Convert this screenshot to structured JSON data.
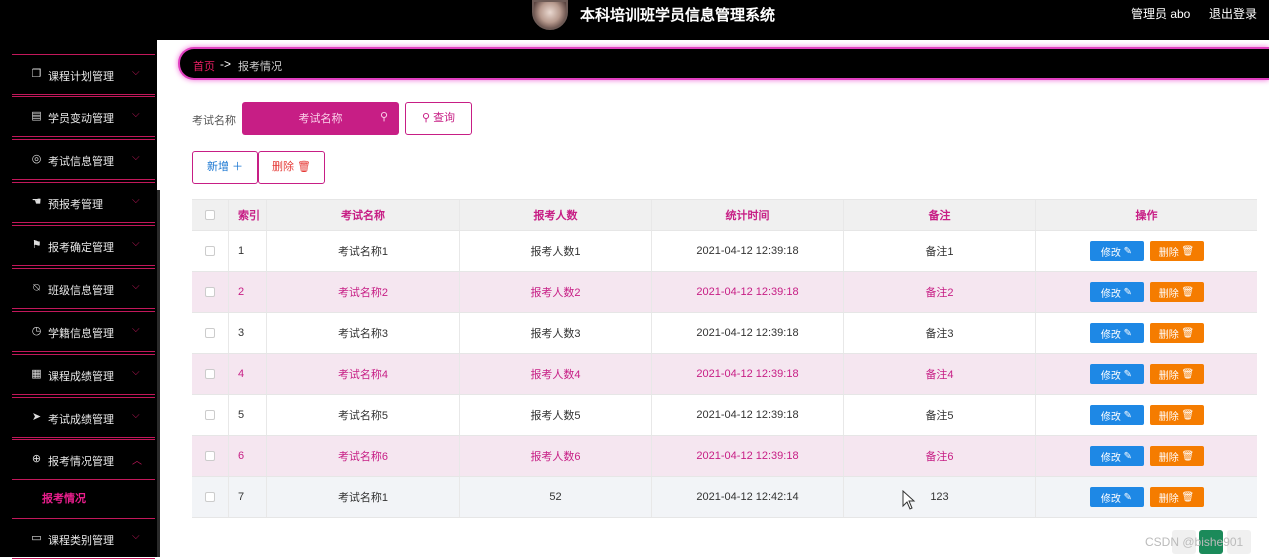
{
  "header": {
    "app_title": "本科培训班学员信息管理系统",
    "user_label": "管理员 abo",
    "logout_label": "退出登录"
  },
  "sidebar": {
    "items": [
      {
        "label": "课程计划管理",
        "icon": "copy-icon"
      },
      {
        "label": "学员变动管理",
        "icon": "chart-icon"
      },
      {
        "label": "考试信息管理",
        "icon": "compass-icon"
      },
      {
        "label": "预报考管理",
        "icon": "thumb-icon"
      },
      {
        "label": "报考确定管理",
        "icon": "flag-icon"
      },
      {
        "label": "班级信息管理",
        "icon": "bell-off-icon"
      },
      {
        "label": "学籍信息管理",
        "icon": "time-icon"
      },
      {
        "label": "课程成绩管理",
        "icon": "grid-icon"
      },
      {
        "label": "考试成绩管理",
        "icon": "send-icon"
      },
      {
        "label": "报考情况管理",
        "icon": "target-icon"
      },
      {
        "label": "课程类别管理",
        "icon": "monitor-icon"
      }
    ],
    "active_submenu": "报考情况"
  },
  "breadcrumb": {
    "home": "首页",
    "separator": "->",
    "current": "报考情况"
  },
  "search": {
    "label": "考试名称",
    "placeholder": "考试名称",
    "query_button": "查询"
  },
  "actions": {
    "add_button": "新增",
    "delete_button": "删除"
  },
  "table": {
    "columns": [
      "索引",
      "考试名称",
      "报考人数",
      "统计时间",
      "备注",
      "操作"
    ],
    "rows": [
      {
        "idx": "1",
        "name": "考试名称1",
        "count": "报考人数1",
        "time": "2021-04-12 12:39:18",
        "note": "备注1"
      },
      {
        "idx": "2",
        "name": "考试名称2",
        "count": "报考人数2",
        "time": "2021-04-12 12:39:18",
        "note": "备注2"
      },
      {
        "idx": "3",
        "name": "考试名称3",
        "count": "报考人数3",
        "time": "2021-04-12 12:39:18",
        "note": "备注3"
      },
      {
        "idx": "4",
        "name": "考试名称4",
        "count": "报考人数4",
        "time": "2021-04-12 12:39:18",
        "note": "备注4"
      },
      {
        "idx": "5",
        "name": "考试名称5",
        "count": "报考人数5",
        "time": "2021-04-12 12:39:18",
        "note": "备注5"
      },
      {
        "idx": "6",
        "name": "考试名称6",
        "count": "报考人数6",
        "time": "2021-04-12 12:39:18",
        "note": "备注6"
      },
      {
        "idx": "7",
        "name": "考试名称1",
        "count": "52",
        "time": "2021-04-12 12:42:14",
        "note": "123"
      }
    ],
    "edit_label": "修改",
    "delete_label": "删除"
  },
  "watermark": "CSDN @bishe901",
  "colors": {
    "accent": "#c71e85",
    "edit": "#1e88e5",
    "delete": "#f57c00"
  }
}
